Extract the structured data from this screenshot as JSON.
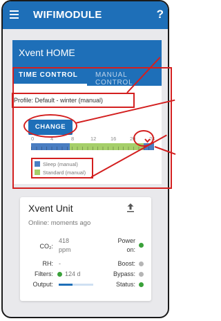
{
  "app": {
    "title": "WIFIMODULE",
    "help": "?"
  },
  "home_card": {
    "title": "Xvent HOME",
    "tabs": [
      {
        "label": "TIME CONTROL",
        "active": true
      },
      {
        "label": "MANUAL CONTROL",
        "active": false
      }
    ],
    "profile": "Profile: Default - winter (manual)",
    "change_label": "CHANGE",
    "ticks": [
      "0",
      "4",
      "8",
      "12",
      "16",
      "20",
      "24"
    ],
    "schedule": [
      {
        "mode": "sleep",
        "from": 0,
        "to": 7.5
      },
      {
        "mode": "standard",
        "from": 7.5,
        "to": 22
      },
      {
        "mode": "sleep",
        "from": 22,
        "to": 24
      }
    ],
    "legend": [
      {
        "label": "Sleep (manual)",
        "color": "#4a7ec2"
      },
      {
        "label": "Standard (manual)",
        "color": "#a6cf6a"
      }
    ]
  },
  "unit_card": {
    "title": "Xvent Unit",
    "online": "Online: moments ago",
    "co2_label": "CO₂:",
    "co2_value": "418",
    "co2_unit": "ppm",
    "rh_label": "RH:",
    "rh_value": "-",
    "filters_label": "Filters:",
    "filters_value": "124 d",
    "output_label": "Output:",
    "power_label_1": "Power",
    "power_label_2": "on:",
    "boost_label": "Boost:",
    "bypass_label": "Bypass:",
    "status_label": "Status:",
    "colors": {
      "on": "#3aa13a",
      "off": "#b5b5b5",
      "accent": "#1e6fb8"
    }
  }
}
